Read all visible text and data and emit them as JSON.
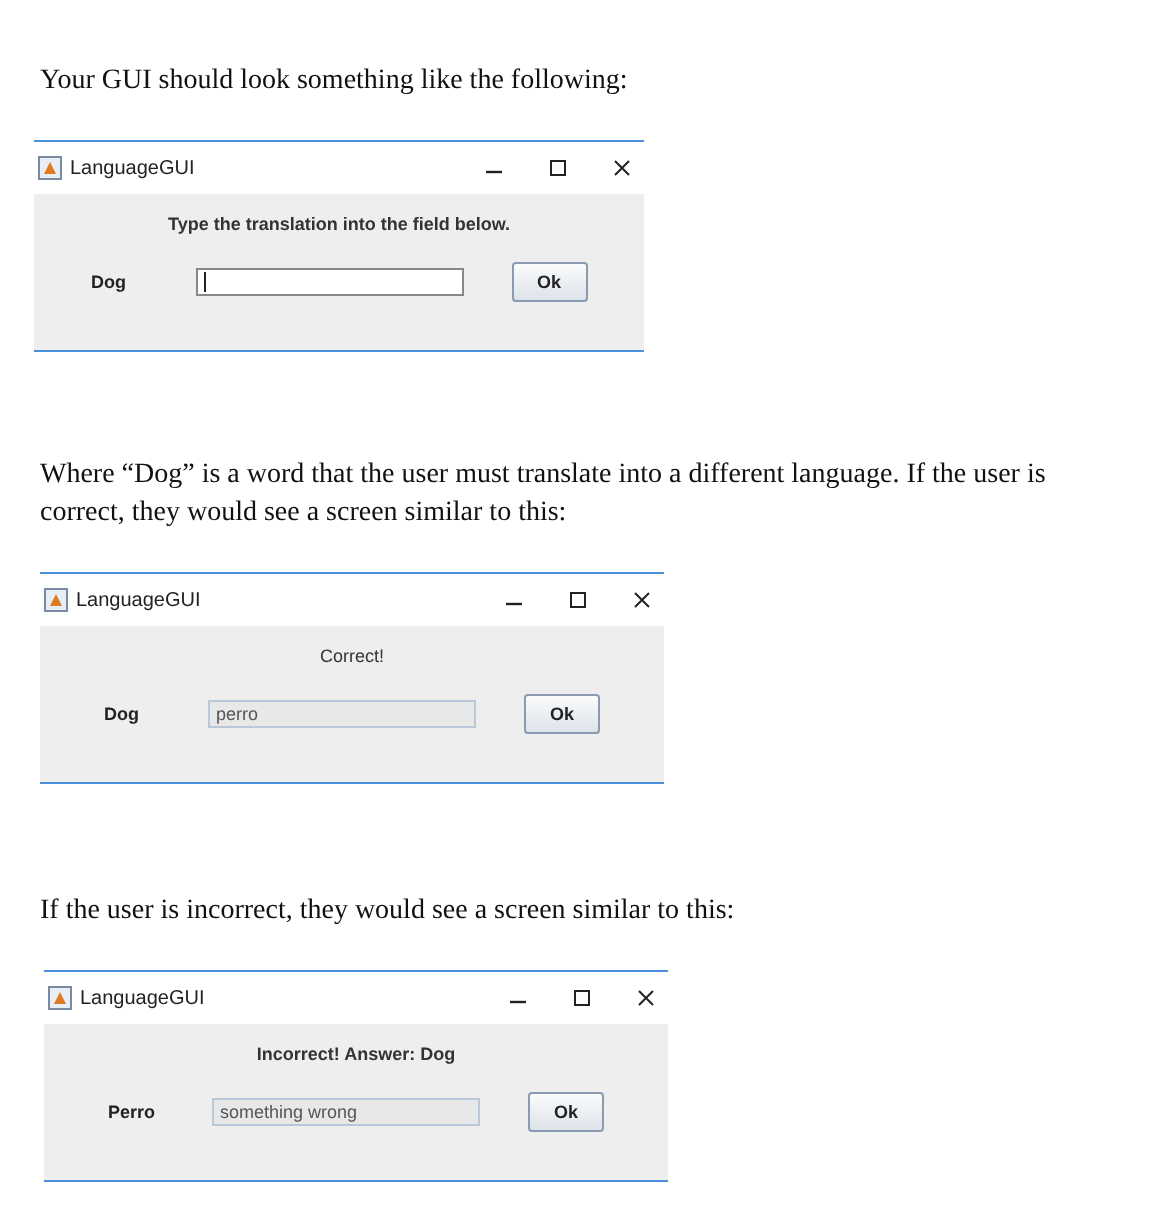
{
  "intro": "Your GUI should look something like the following:",
  "windows": [
    {
      "title": "LanguageGUI",
      "message": {
        "text": "Type the translation into the field below.",
        "bold": true
      },
      "word": "Dog",
      "field": {
        "disabled": false
      },
      "ok": "Ok"
    },
    {
      "title": "LanguageGUI",
      "message": {
        "text": "Correct!",
        "bold": false
      },
      "word": "Dog",
      "field": {
        "value": "perro",
        "disabled": true
      },
      "ok": "Ok"
    },
    {
      "title": "LanguageGUI",
      "message": {
        "text": "Incorrect! Answer: Dog",
        "bold": true
      },
      "word": "Perro",
      "field": {
        "value": "something wrong",
        "disabled": true
      },
      "ok": "Ok"
    }
  ],
  "paragraphs": [
    "Where “Dog” is a word that the user must translate into a different language. If the user is correct, they would see a screen similar to this:",
    "If the user is incorrect, they would see a screen similar to this:"
  ]
}
